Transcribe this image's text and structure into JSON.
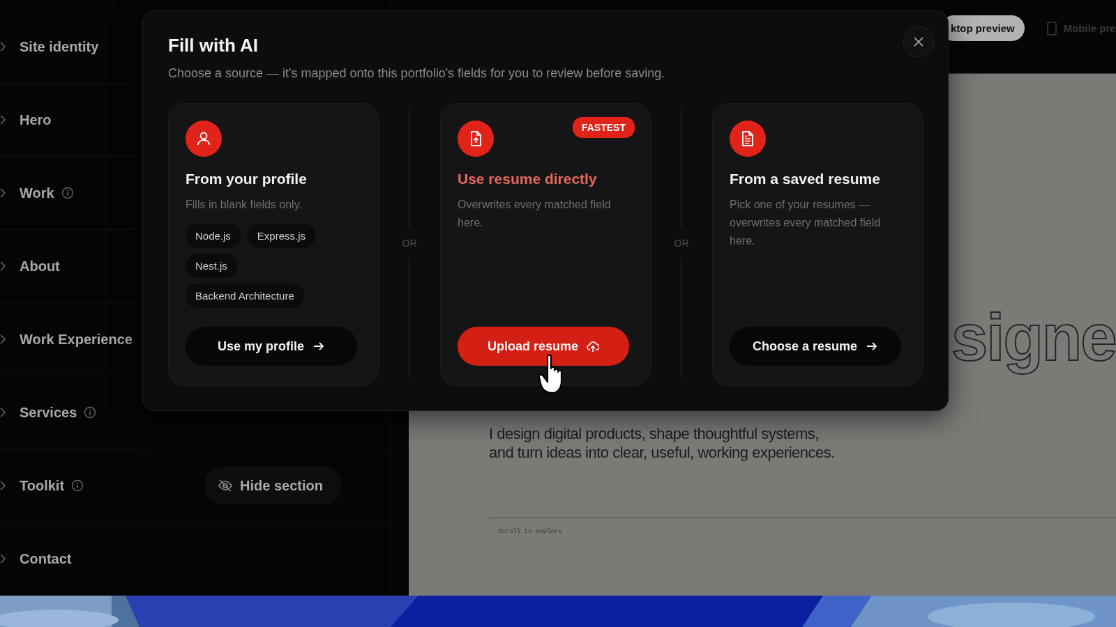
{
  "sidebar": {
    "items": [
      {
        "label": "Site identity",
        "info": false
      },
      {
        "label": "Hero",
        "info": false
      },
      {
        "label": "Work",
        "info": true
      },
      {
        "label": "About",
        "info": false
      },
      {
        "label": "Work Experience",
        "info": false
      },
      {
        "label": "Services",
        "info": true
      },
      {
        "label": "Toolkit",
        "info": true,
        "hide_button": "Hide section"
      },
      {
        "label": "Contact",
        "info": false
      }
    ]
  },
  "preview": {
    "tabs": [
      {
        "label": "ktop preview",
        "selected": true,
        "kind": "desktop"
      },
      {
        "label": "Mobile pre",
        "selected": false,
        "kind": "mobile"
      }
    ],
    "hero_word": "signe",
    "tagline": "I design digital products, shape thoughtful systems,\nand turn ideas into clear, useful, working experiences.",
    "scroll_hint": "Scroll to explore"
  },
  "modal": {
    "title": "Fill with AI",
    "subtitle": "Choose a source — it's mapped onto this portfolio's fields for you to review before saving.",
    "separators": [
      "OR",
      "OR"
    ],
    "cards": [
      {
        "kind": "profile",
        "title": "From your profile",
        "highlighted": false,
        "description": "Fills in blank fields only.",
        "tags": [
          "Node.js",
          "Express.js",
          "Nest.js",
          "Backend Architecture"
        ],
        "button": "Use my profile",
        "primary": false
      },
      {
        "kind": "upload",
        "badge": "FASTEST",
        "title": "Use resume directly",
        "highlighted": true,
        "description": "Overwrites every matched field here.",
        "button": "Upload resume",
        "primary": true
      },
      {
        "kind": "saved",
        "title": "From a saved resume",
        "highlighted": false,
        "description": "Pick one of your resumes — overwrites every matched field here.",
        "button": "Choose a resume",
        "primary": false
      }
    ]
  }
}
